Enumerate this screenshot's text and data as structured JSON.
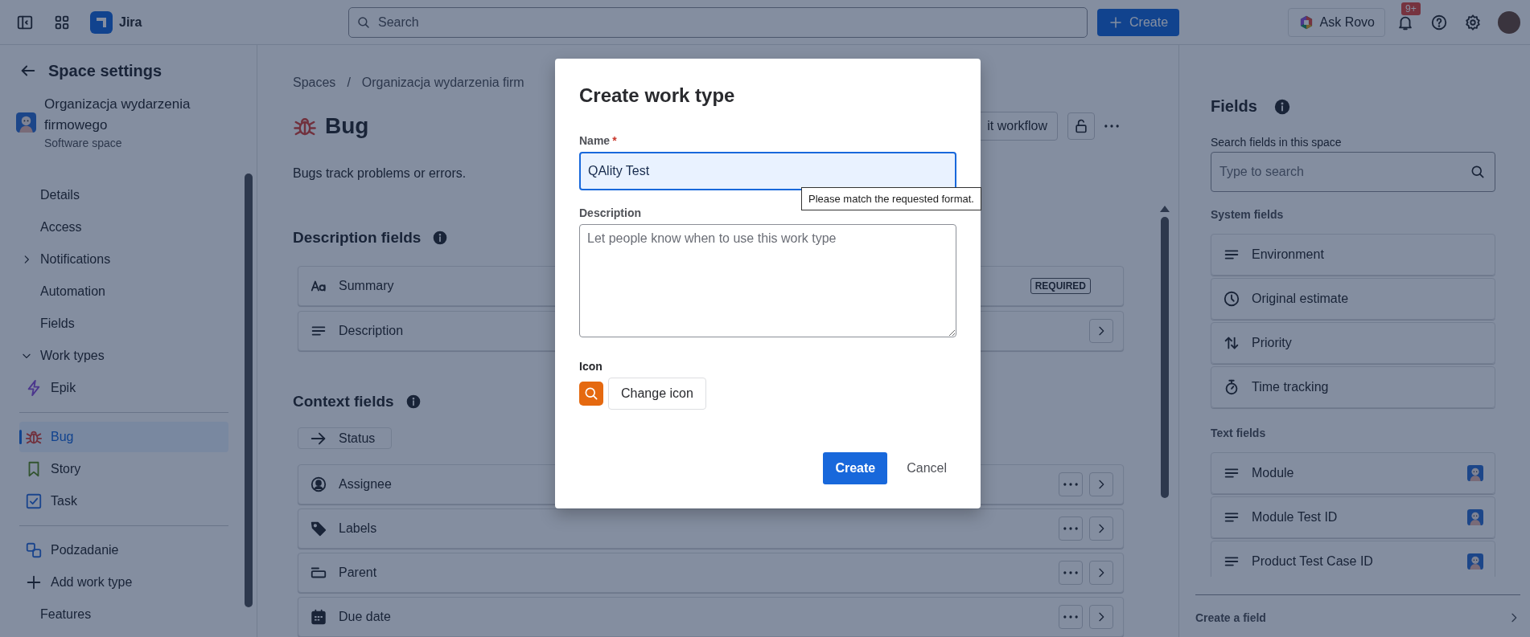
{
  "top_bar": {
    "product": "Jira",
    "search": {
      "placeholder": "Search"
    },
    "create_button": "Create",
    "rovo_button": "Ask Rovo",
    "notifications_badge": "9+"
  },
  "sidebar": {
    "title": "Space settings",
    "space": {
      "name": "Organizacja wydarzenia firmowego",
      "type": "Software space"
    },
    "items": [
      {
        "label": "Details",
        "kind": "link",
        "selected": false
      },
      {
        "label": "Access",
        "kind": "link",
        "selected": false
      },
      {
        "label": "Notifications",
        "kind": "group",
        "expanded": false,
        "selected": false
      },
      {
        "label": "Automation",
        "kind": "link",
        "selected": false
      },
      {
        "label": "Fields",
        "kind": "link",
        "selected": false
      },
      {
        "label": "Work types",
        "kind": "group",
        "expanded": true,
        "selected": false,
        "children": [
          {
            "items": [
              {
                "label": "Epik",
                "kind": "epic",
                "selected": false
              }
            ]
          },
          {
            "items": [
              {
                "label": "Bug",
                "kind": "bug",
                "selected": true
              },
              {
                "label": "Story",
                "kind": "story",
                "selected": false
              },
              {
                "label": "Task",
                "kind": "task",
                "selected": false
              }
            ]
          },
          {
            "items": [
              {
                "label": "Podzadanie",
                "kind": "subtask",
                "selected": false
              },
              {
                "label": "Add work type",
                "kind": "add",
                "selected": false
              }
            ]
          }
        ]
      },
      {
        "label": "Features",
        "kind": "link",
        "selected": false
      }
    ]
  },
  "main": {
    "breadcrumbs": [
      "Spaces",
      "Organizacja wydarzenia firm"
    ],
    "breadcrumb_separator": "/",
    "title": "Bug",
    "workflow_button": "it workflow",
    "description": "Bugs track problems or errors.",
    "description_fields": {
      "title": "Description fields",
      "items": [
        {
          "label": "Summary",
          "kind": "text",
          "badge": "REQUIRED"
        },
        {
          "label": "Description",
          "kind": "paragraph"
        }
      ]
    },
    "context_fields": {
      "title": "Context fields",
      "pinned": [
        {
          "label": "Status",
          "kind": "status"
        }
      ],
      "items": [
        {
          "label": "Assignee",
          "kind": "person"
        },
        {
          "label": "Labels",
          "kind": "label"
        },
        {
          "label": "Parent",
          "kind": "parent"
        },
        {
          "label": "Due date",
          "kind": "date"
        }
      ]
    }
  },
  "fields_panel": {
    "title": "Fields",
    "search_label": "Search fields in this space",
    "search": {
      "placeholder": "Type to search"
    },
    "groups": [
      {
        "title": "System fields",
        "items": [
          {
            "label": "Environment",
            "kind": "paragraph",
            "space_avatar": false
          },
          {
            "label": "Original estimate",
            "kind": "clock",
            "space_avatar": false
          },
          {
            "label": "Priority",
            "kind": "priority",
            "space_avatar": false
          },
          {
            "label": "Time tracking",
            "kind": "timer",
            "space_avatar": false
          }
        ]
      },
      {
        "title": "Text fields",
        "items": [
          {
            "label": "Module",
            "kind": "paragraph",
            "space_avatar": true
          },
          {
            "label": "Module Test ID",
            "kind": "paragraph",
            "space_avatar": true
          },
          {
            "label": "Product Test Case ID",
            "kind": "paragraph",
            "space_avatar": true
          }
        ]
      }
    ],
    "create_link": "Create a field"
  },
  "modal": {
    "title": "Create work type",
    "name": {
      "label": "Name",
      "required_mark": "*",
      "value": "QAlity Test"
    },
    "tooltip": "Please match the requested format.",
    "description": {
      "label": "Description",
      "placeholder": "Let people know when to use this work type"
    },
    "icon": {
      "label": "Icon",
      "button": "Change icon"
    },
    "buttons": [
      {
        "label": "Create",
        "kind": "primary"
      },
      {
        "label": "Cancel",
        "kind": "subtle"
      }
    ]
  }
}
